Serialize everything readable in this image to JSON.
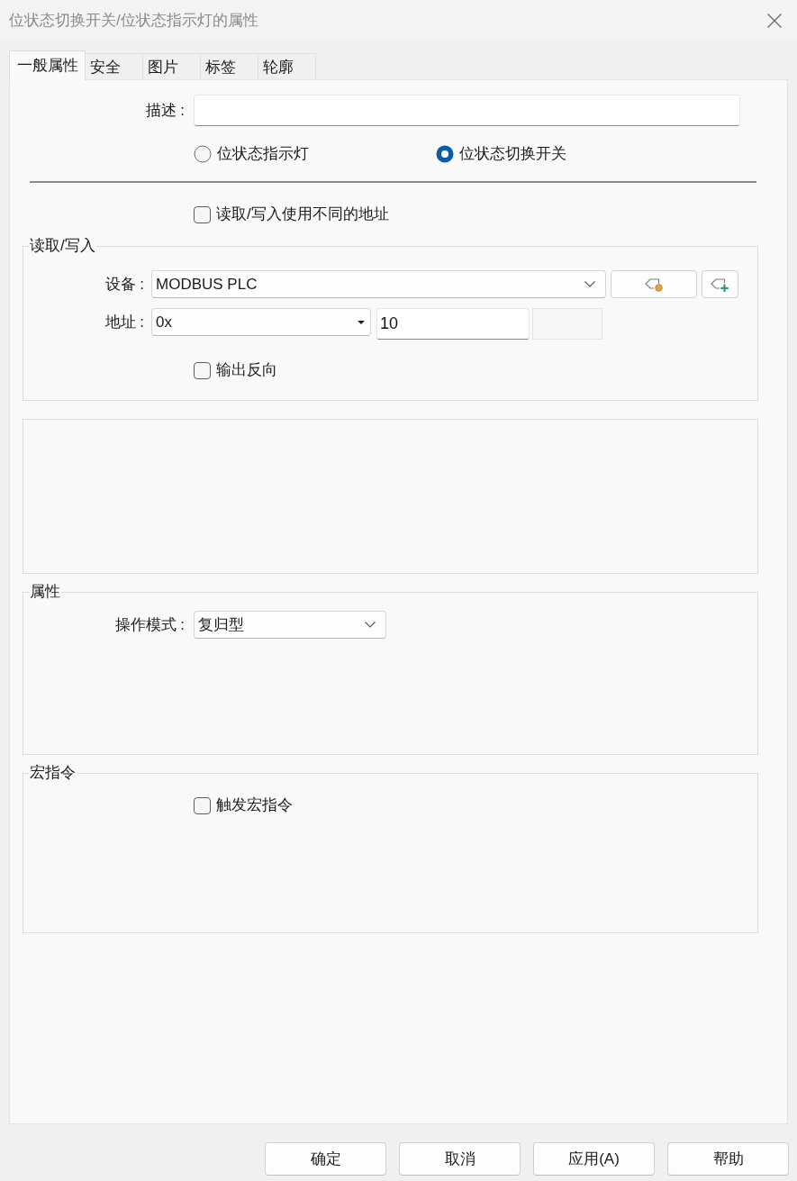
{
  "window": {
    "title": "位状态切换开关/位状态指示灯的属性"
  },
  "tabs": [
    {
      "label": "一般属性",
      "selected": true
    },
    {
      "label": "安全",
      "selected": false
    },
    {
      "label": "图片",
      "selected": false
    },
    {
      "label": "标签",
      "selected": false
    },
    {
      "label": "轮廓",
      "selected": false
    }
  ],
  "general": {
    "description": {
      "label": "描述 :"
    },
    "object_type": [
      {
        "label": "位状态指示灯",
        "selected": false
      },
      {
        "label": "位状态切换开关",
        "selected": true
      }
    ],
    "different_addresses": {
      "label": "读取/写入使用不同的地址",
      "checked": false
    }
  },
  "read_write": {
    "title": "读取/写入",
    "device": {
      "label": "设备 :",
      "value": "MODBUS PLC"
    },
    "address": {
      "label": "地址 :",
      "type": "0x",
      "value": "10"
    },
    "invert_output": {
      "label": "输出反向",
      "checked": false
    }
  },
  "attributes": {
    "title": "属性",
    "operation_mode": {
      "label": "操作模式 :",
      "value": "复归型"
    }
  },
  "macro": {
    "title": "宏指令",
    "trigger_macro": {
      "label": "触发宏指令",
      "checked": false
    }
  },
  "buttons": [
    {
      "label": "确定"
    },
    {
      "label": "取消"
    },
    {
      "label": "应用(A)"
    },
    {
      "label": "帮助"
    }
  ]
}
